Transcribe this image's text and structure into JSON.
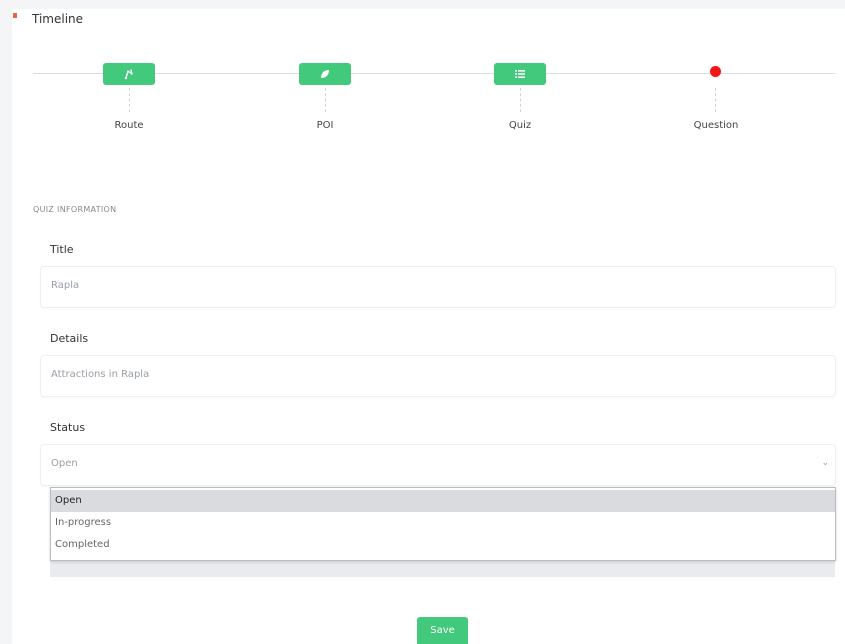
{
  "timeline": {
    "title": "Timeline",
    "steps": [
      {
        "label": "Route",
        "icon": "route-icon",
        "state": "done"
      },
      {
        "label": "POI",
        "icon": "leaf-icon",
        "state": "done"
      },
      {
        "label": "Quiz",
        "icon": "list-icon",
        "state": "done"
      },
      {
        "label": "Question",
        "icon": "red-dot",
        "state": "current"
      }
    ]
  },
  "section": {
    "label": "QUIZ INFORMATION"
  },
  "form": {
    "title": {
      "label": "Title",
      "value": "Rapla"
    },
    "details": {
      "label": "Details",
      "value": "Attractions in Rapla"
    },
    "status": {
      "label": "Status",
      "value": "Open",
      "options": [
        "Open",
        "In-progress",
        "Completed"
      ],
      "chevron": "⌄"
    }
  },
  "actions": {
    "save_label": "Save"
  },
  "colors": {
    "accent": "#43c97b",
    "current": "#f01616",
    "marker": "#e8683b"
  }
}
